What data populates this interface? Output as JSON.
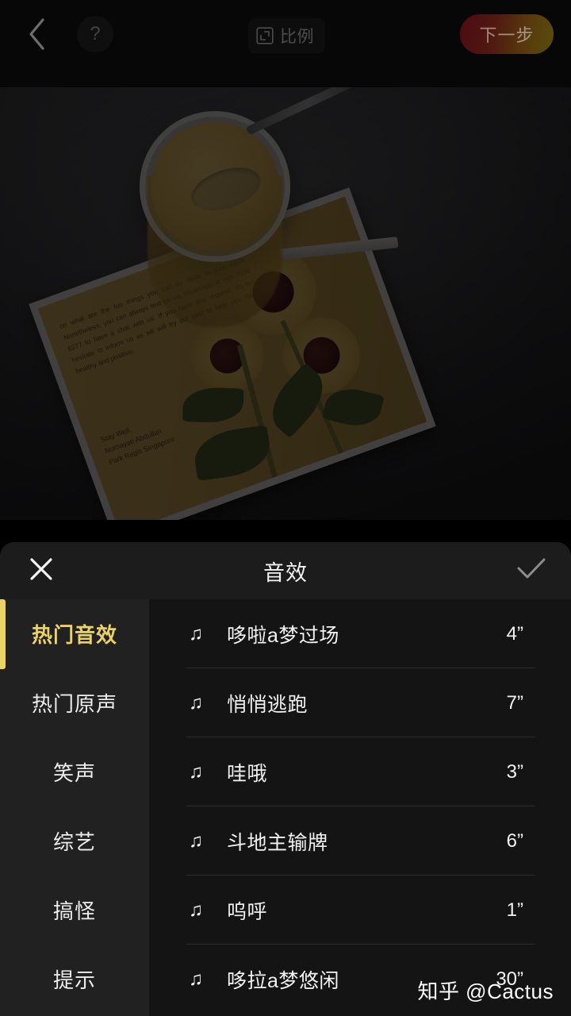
{
  "editor": {
    "topbar": {
      "back_icon": "chevron-left-icon",
      "help_label": "?",
      "ratio_icon": "crop-ratio-icon",
      "ratio_label": "比例",
      "next_label": "下一步",
      "next_gradient_from": "#8a1424",
      "next_gradient_to": "#a08a16"
    },
    "photo": {
      "description": "俯拍桌面上的塑料杯饮品与向日葵卡片",
      "card_body_text": "on what are the fun things you can do while in your room.  Nonetheless, you can always text us via WhatsApp at +65 8139 6277 to have a chat with us.  If you have any request, do not hesitate to inform us as we will try our best to help you.  Stay healthy and positive.",
      "card_signoff": "Stay Well,\nNurhayati Abdullah\nPark Regis Singapore",
      "dim_overlay": "rgba(0,0,0,0.70)"
    }
  },
  "sheet": {
    "close_icon": "close-icon",
    "title": "音效",
    "done_icon": "check-icon",
    "accent_color": "#e9d463",
    "categories": [
      {
        "label": "热门音效",
        "active": true
      },
      {
        "label": "热门原声",
        "active": false
      },
      {
        "label": "笑声",
        "active": false
      },
      {
        "label": "综艺",
        "active": false
      },
      {
        "label": "搞怪",
        "active": false
      },
      {
        "label": "提示",
        "active": false
      }
    ],
    "sounds": [
      {
        "icon": "music-note-icon",
        "name": "哆啦a梦过场",
        "duration": "4”"
      },
      {
        "icon": "music-note-icon",
        "name": "悄悄逃跑",
        "duration": "7”"
      },
      {
        "icon": "music-note-icon",
        "name": "哇哦",
        "duration": "3”"
      },
      {
        "icon": "music-note-icon",
        "name": "斗地主输牌",
        "duration": "6”"
      },
      {
        "icon": "music-note-icon",
        "name": "呜呼",
        "duration": "1”"
      },
      {
        "icon": "music-note-icon",
        "name": "哆拉a梦悠闲",
        "duration": "30”"
      }
    ]
  },
  "watermark": {
    "text": "知乎 @Cactus"
  }
}
